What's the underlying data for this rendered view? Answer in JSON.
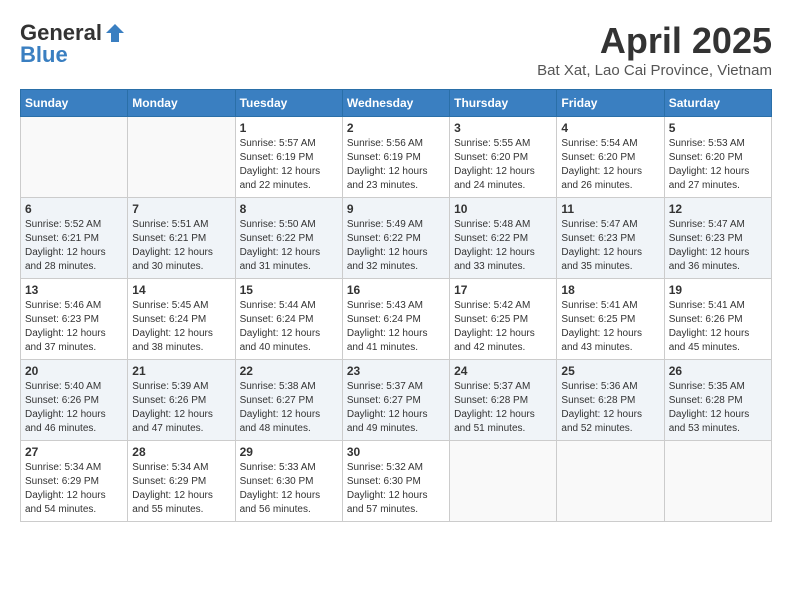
{
  "header": {
    "logo_general": "General",
    "logo_blue": "Blue",
    "month_title": "April 2025",
    "location": "Bat Xat, Lao Cai Province, Vietnam"
  },
  "weekdays": [
    "Sunday",
    "Monday",
    "Tuesday",
    "Wednesday",
    "Thursday",
    "Friday",
    "Saturday"
  ],
  "weeks": [
    [
      {
        "day": "",
        "sunrise": "",
        "sunset": "",
        "daylight": ""
      },
      {
        "day": "",
        "sunrise": "",
        "sunset": "",
        "daylight": ""
      },
      {
        "day": "1",
        "sunrise": "Sunrise: 5:57 AM",
        "sunset": "Sunset: 6:19 PM",
        "daylight": "Daylight: 12 hours and 22 minutes."
      },
      {
        "day": "2",
        "sunrise": "Sunrise: 5:56 AM",
        "sunset": "Sunset: 6:19 PM",
        "daylight": "Daylight: 12 hours and 23 minutes."
      },
      {
        "day": "3",
        "sunrise": "Sunrise: 5:55 AM",
        "sunset": "Sunset: 6:20 PM",
        "daylight": "Daylight: 12 hours and 24 minutes."
      },
      {
        "day": "4",
        "sunrise": "Sunrise: 5:54 AM",
        "sunset": "Sunset: 6:20 PM",
        "daylight": "Daylight: 12 hours and 26 minutes."
      },
      {
        "day": "5",
        "sunrise": "Sunrise: 5:53 AM",
        "sunset": "Sunset: 6:20 PM",
        "daylight": "Daylight: 12 hours and 27 minutes."
      }
    ],
    [
      {
        "day": "6",
        "sunrise": "Sunrise: 5:52 AM",
        "sunset": "Sunset: 6:21 PM",
        "daylight": "Daylight: 12 hours and 28 minutes."
      },
      {
        "day": "7",
        "sunrise": "Sunrise: 5:51 AM",
        "sunset": "Sunset: 6:21 PM",
        "daylight": "Daylight: 12 hours and 30 minutes."
      },
      {
        "day": "8",
        "sunrise": "Sunrise: 5:50 AM",
        "sunset": "Sunset: 6:22 PM",
        "daylight": "Daylight: 12 hours and 31 minutes."
      },
      {
        "day": "9",
        "sunrise": "Sunrise: 5:49 AM",
        "sunset": "Sunset: 6:22 PM",
        "daylight": "Daylight: 12 hours and 32 minutes."
      },
      {
        "day": "10",
        "sunrise": "Sunrise: 5:48 AM",
        "sunset": "Sunset: 6:22 PM",
        "daylight": "Daylight: 12 hours and 33 minutes."
      },
      {
        "day": "11",
        "sunrise": "Sunrise: 5:47 AM",
        "sunset": "Sunset: 6:23 PM",
        "daylight": "Daylight: 12 hours and 35 minutes."
      },
      {
        "day": "12",
        "sunrise": "Sunrise: 5:47 AM",
        "sunset": "Sunset: 6:23 PM",
        "daylight": "Daylight: 12 hours and 36 minutes."
      }
    ],
    [
      {
        "day": "13",
        "sunrise": "Sunrise: 5:46 AM",
        "sunset": "Sunset: 6:23 PM",
        "daylight": "Daylight: 12 hours and 37 minutes."
      },
      {
        "day": "14",
        "sunrise": "Sunrise: 5:45 AM",
        "sunset": "Sunset: 6:24 PM",
        "daylight": "Daylight: 12 hours and 38 minutes."
      },
      {
        "day": "15",
        "sunrise": "Sunrise: 5:44 AM",
        "sunset": "Sunset: 6:24 PM",
        "daylight": "Daylight: 12 hours and 40 minutes."
      },
      {
        "day": "16",
        "sunrise": "Sunrise: 5:43 AM",
        "sunset": "Sunset: 6:24 PM",
        "daylight": "Daylight: 12 hours and 41 minutes."
      },
      {
        "day": "17",
        "sunrise": "Sunrise: 5:42 AM",
        "sunset": "Sunset: 6:25 PM",
        "daylight": "Daylight: 12 hours and 42 minutes."
      },
      {
        "day": "18",
        "sunrise": "Sunrise: 5:41 AM",
        "sunset": "Sunset: 6:25 PM",
        "daylight": "Daylight: 12 hours and 43 minutes."
      },
      {
        "day": "19",
        "sunrise": "Sunrise: 5:41 AM",
        "sunset": "Sunset: 6:26 PM",
        "daylight": "Daylight: 12 hours and 45 minutes."
      }
    ],
    [
      {
        "day": "20",
        "sunrise": "Sunrise: 5:40 AM",
        "sunset": "Sunset: 6:26 PM",
        "daylight": "Daylight: 12 hours and 46 minutes."
      },
      {
        "day": "21",
        "sunrise": "Sunrise: 5:39 AM",
        "sunset": "Sunset: 6:26 PM",
        "daylight": "Daylight: 12 hours and 47 minutes."
      },
      {
        "day": "22",
        "sunrise": "Sunrise: 5:38 AM",
        "sunset": "Sunset: 6:27 PM",
        "daylight": "Daylight: 12 hours and 48 minutes."
      },
      {
        "day": "23",
        "sunrise": "Sunrise: 5:37 AM",
        "sunset": "Sunset: 6:27 PM",
        "daylight": "Daylight: 12 hours and 49 minutes."
      },
      {
        "day": "24",
        "sunrise": "Sunrise: 5:37 AM",
        "sunset": "Sunset: 6:28 PM",
        "daylight": "Daylight: 12 hours and 51 minutes."
      },
      {
        "day": "25",
        "sunrise": "Sunrise: 5:36 AM",
        "sunset": "Sunset: 6:28 PM",
        "daylight": "Daylight: 12 hours and 52 minutes."
      },
      {
        "day": "26",
        "sunrise": "Sunrise: 5:35 AM",
        "sunset": "Sunset: 6:28 PM",
        "daylight": "Daylight: 12 hours and 53 minutes."
      }
    ],
    [
      {
        "day": "27",
        "sunrise": "Sunrise: 5:34 AM",
        "sunset": "Sunset: 6:29 PM",
        "daylight": "Daylight: 12 hours and 54 minutes."
      },
      {
        "day": "28",
        "sunrise": "Sunrise: 5:34 AM",
        "sunset": "Sunset: 6:29 PM",
        "daylight": "Daylight: 12 hours and 55 minutes."
      },
      {
        "day": "29",
        "sunrise": "Sunrise: 5:33 AM",
        "sunset": "Sunset: 6:30 PM",
        "daylight": "Daylight: 12 hours and 56 minutes."
      },
      {
        "day": "30",
        "sunrise": "Sunrise: 5:32 AM",
        "sunset": "Sunset: 6:30 PM",
        "daylight": "Daylight: 12 hours and 57 minutes."
      },
      {
        "day": "",
        "sunrise": "",
        "sunset": "",
        "daylight": ""
      },
      {
        "day": "",
        "sunrise": "",
        "sunset": "",
        "daylight": ""
      },
      {
        "day": "",
        "sunrise": "",
        "sunset": "",
        "daylight": ""
      }
    ]
  ]
}
